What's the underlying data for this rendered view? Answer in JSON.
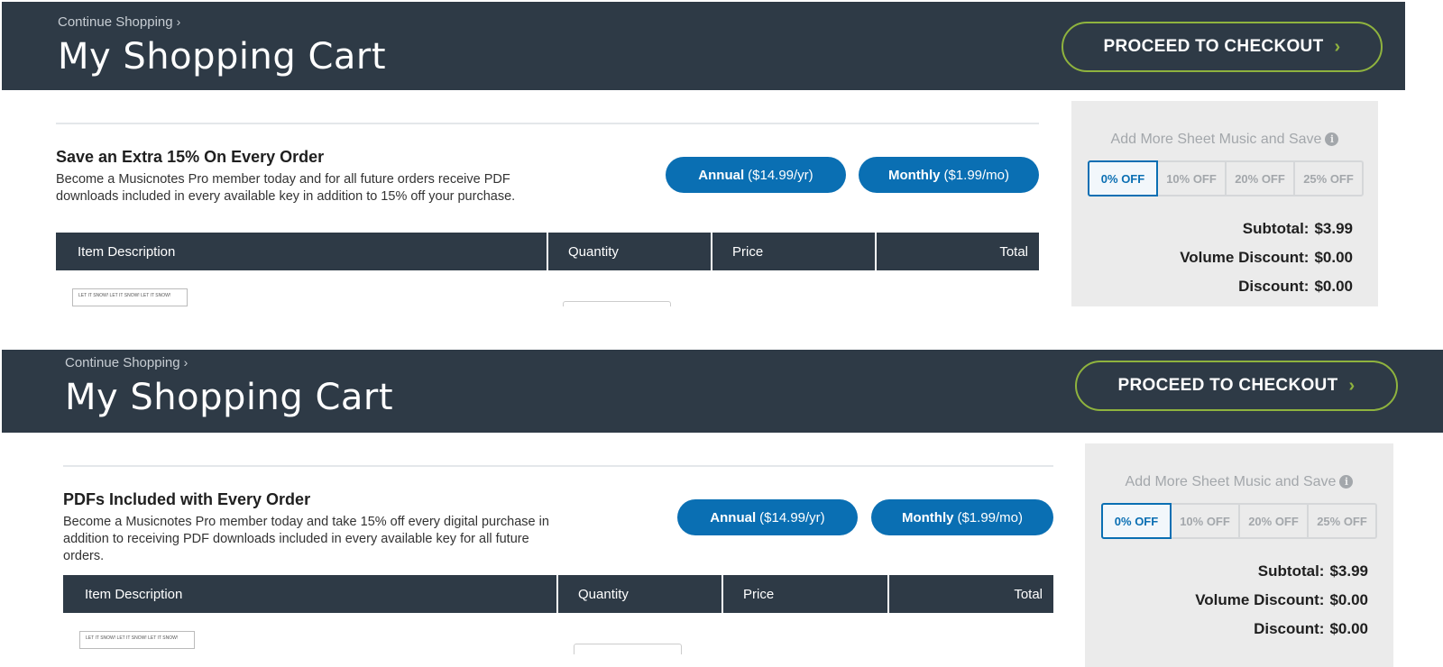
{
  "panels": [
    {
      "continue_label": "Continue Shopping",
      "title": "My Shopping Cart",
      "checkout_label": "PROCEED TO CHECKOUT",
      "promo": {
        "heading": "Save an Extra 15% On Every Order",
        "text": "Become a Musicnotes Pro member today and for all future orders receive PDF downloads included in every available key in addition to 15% off your purchase."
      },
      "plans": {
        "annual_name": "Annual",
        "annual_price": "($14.99/yr)",
        "monthly_name": "Monthly",
        "monthly_price": "($1.99/mo)"
      },
      "table_headers": [
        "Item Description",
        "Quantity",
        "Price",
        "Total"
      ],
      "item_thumb_text": "LET IT SNOW! LET IT SNOW! LET IT SNOW!",
      "summary": {
        "title": "Add More Sheet Music and Save",
        "tiers": [
          "0% OFF",
          "10% OFF",
          "20% OFF",
          "25% OFF"
        ],
        "active_tier": "0% OFF",
        "subtotal_label": "Subtotal:",
        "subtotal_value": "$3.99",
        "volume_label": "Volume Discount:",
        "volume_value": "$0.00",
        "discount_label": "Discount:",
        "discount_value": "$0.00"
      }
    },
    {
      "continue_label": "Continue Shopping",
      "title": "My Shopping Cart",
      "checkout_label": "PROCEED TO CHECKOUT",
      "promo": {
        "heading": "PDFs Included with Every Order",
        "text": "Become a Musicnotes Pro member today and take 15% off every digital purchase in addition to receiving PDF downloads included in every available key for all future orders."
      },
      "plans": {
        "annual_name": "Annual",
        "annual_price": "($14.99/yr)",
        "monthly_name": "Monthly",
        "monthly_price": "($1.99/mo)"
      },
      "table_headers": [
        "Item Description",
        "Quantity",
        "Price",
        "Total"
      ],
      "item_thumb_text": "LET IT SNOW! LET IT SNOW! LET IT SNOW!",
      "summary": {
        "title": "Add More Sheet Music and Save",
        "tiers": [
          "0% OFF",
          "10% OFF",
          "20% OFF",
          "25% OFF"
        ],
        "active_tier": "0% OFF",
        "subtotal_label": "Subtotal:",
        "subtotal_value": "$3.99",
        "volume_label": "Volume Discount:",
        "volume_value": "$0.00",
        "discount_label": "Discount:",
        "discount_value": "$0.00"
      }
    }
  ],
  "colors": {
    "header_bg": "#2e3a46",
    "accent_green": "#8fb33e",
    "button_blue": "#0a6fb3",
    "summary_bg": "#ebebeb"
  },
  "icons": {
    "continue": "chevron-right-icon",
    "checkout": "chevron-right-icon",
    "info": "info-icon"
  }
}
